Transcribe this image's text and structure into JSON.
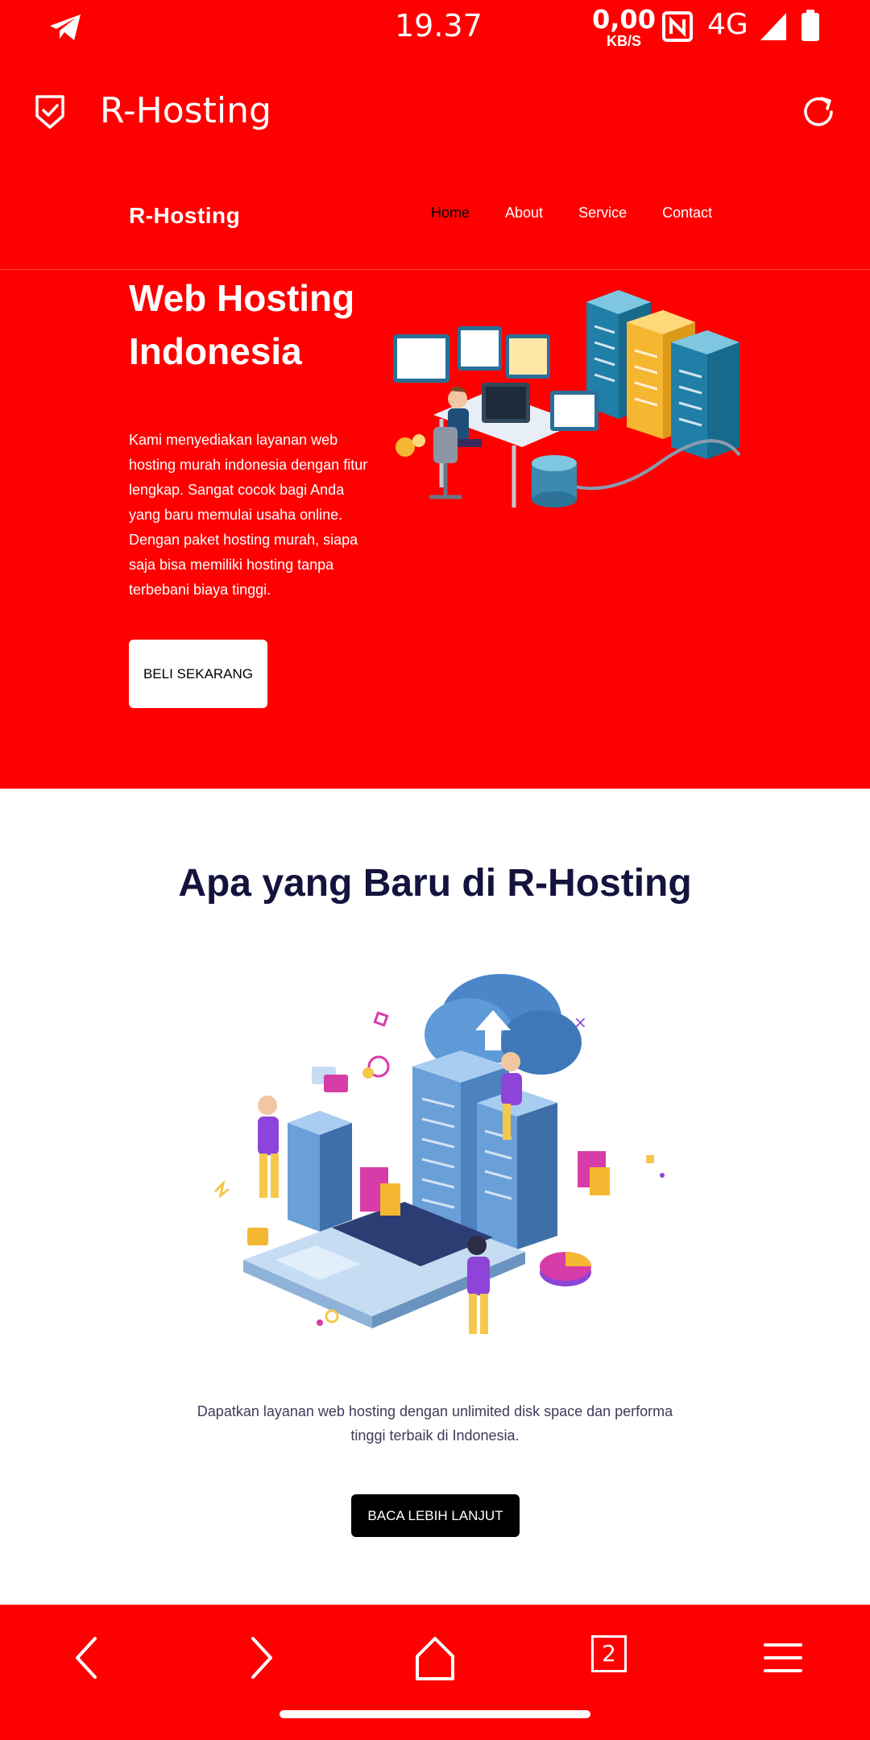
{
  "status_bar": {
    "time": "19.37",
    "speed_value": "0,00",
    "speed_unit": "KB/S",
    "network": "4G",
    "icons": [
      "telegram-icon",
      "nfc-icon",
      "signal-icon",
      "battery-icon"
    ]
  },
  "browser": {
    "title": "R-Hosting",
    "icons": [
      "shield-check-icon",
      "reload-icon"
    ]
  },
  "site": {
    "logo": "R-Hosting",
    "nav": [
      {
        "label": "Home",
        "active": true
      },
      {
        "label": "About",
        "active": false
      },
      {
        "label": "Service",
        "active": false
      },
      {
        "label": "Contact",
        "active": false
      }
    ]
  },
  "hero": {
    "title": "Web Hosting Indonesia",
    "description": "Kami menyediakan layanan web hosting murah indonesia dengan fitur lengkap. Sangat cocok bagi Anda yang baru memulai usaha online. Dengan paket hosting murah, siapa saja bisa memiliki hosting tanpa terbebani biaya tinggi.",
    "cta_label": "BELI SEKARANG"
  },
  "news": {
    "title": "Apa yang Baru di R-Hosting",
    "description": "Dapatkan layanan web hosting dengan unlimited disk space dan performa tinggi terbaik di Indonesia.",
    "more_label": "BACA LEBIH LANJUT"
  },
  "bottom_bar": {
    "tabs_count": "2",
    "icons": [
      "back-icon",
      "forward-icon",
      "home-icon",
      "tabs-icon",
      "menu-icon"
    ]
  },
  "colors": {
    "brand_red": "#ff0000",
    "heading_navy": "#14133d",
    "text_gray": "#3c3c5a"
  }
}
